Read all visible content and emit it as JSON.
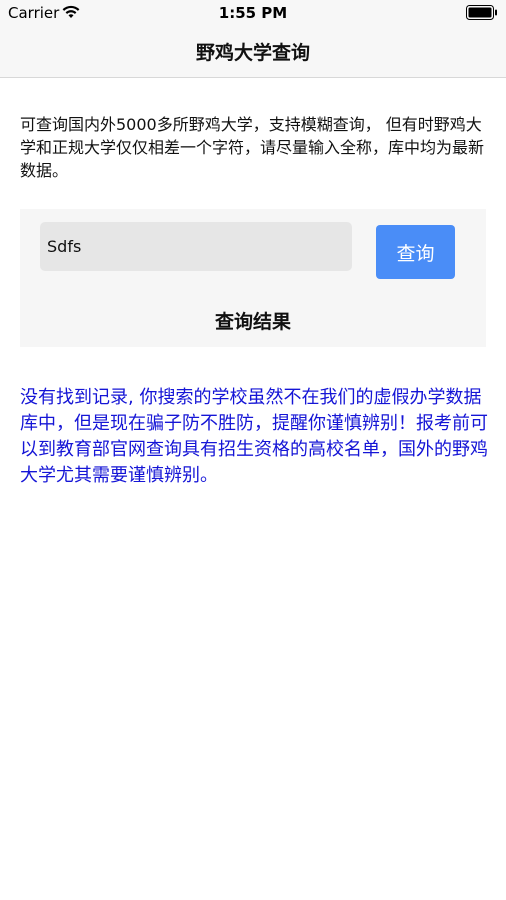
{
  "status_bar": {
    "carrier": "Carrier",
    "time": "1:55 PM",
    "icons": [
      "wifi-icon",
      "battery-icon"
    ]
  },
  "nav": {
    "title": "野鸡大学查询"
  },
  "intro": {
    "text": "可查询国内外5000多所野鸡大学，支持模糊查询， 但有时野鸡大学和正规大学仅仅相差一个字符，请尽量输入全称，库中均为最新数据。"
  },
  "search": {
    "value": "Sdfs",
    "placeholder": "",
    "button_label": "查询"
  },
  "result": {
    "heading": "查询结果",
    "message": "没有找到记录, 你搜索的学校虽然不在我们的虚假办学数据库中，但是现在骗子防不胜防，提醒你谨慎辨别！报考前可以到教育部官网查询具有招生资格的高校名单，国外的野鸡大学尤其需要谨慎辨别。"
  },
  "colors": {
    "button": "#4a8df7",
    "result_text": "#1515d6",
    "panel_bg": "#f6f6f6",
    "input_bg": "#e6e6e6"
  }
}
